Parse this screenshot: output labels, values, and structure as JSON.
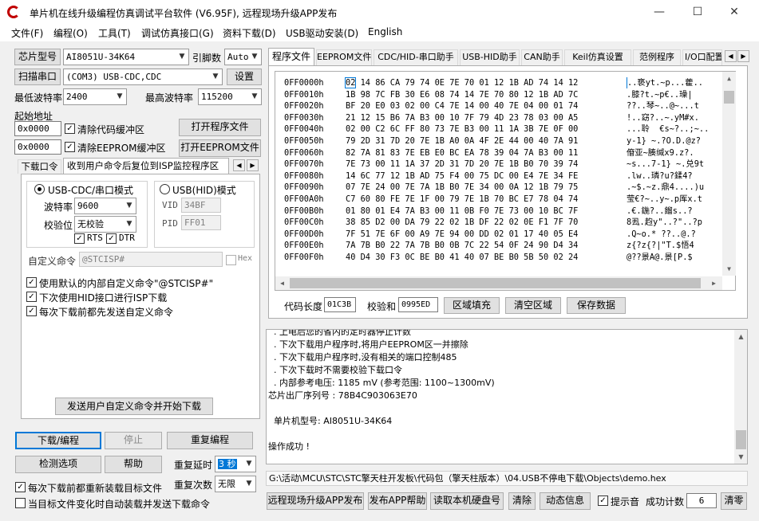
{
  "window": {
    "title": "单片机在线升级编程仿真调试平台软件 (V6.95F), 远程现场升级APP发布",
    "controls": [
      "—",
      "☐",
      "✕"
    ]
  },
  "menu": [
    "文件(F)",
    "编程(O)",
    "工具(T)",
    "调试仿真接口(G)",
    "资料下载(D)",
    "USB驱动安装(D)",
    "English"
  ],
  "left": {
    "chip_type_button": "芯片型号",
    "chip_type_value": "AI8051U-34K64",
    "pin_label": "引脚数",
    "pin_value": "Auto",
    "scan_port_button": "扫描串口",
    "port_value": "(COM3) USB-CDC,CDC",
    "settings_button": "设置",
    "min_baud_label": "最低波特率",
    "min_baud_value": "2400",
    "max_baud_label": "最高波特率",
    "max_baud_value": "115200",
    "start_addr_label": "起始地址",
    "addr1": "0x0000",
    "clear_code_label": "清除代码缓冲区",
    "open_prog_button": "打开程序文件",
    "addr2": "0x0000",
    "clear_eeprom_label": "清除EEPROM缓冲区",
    "open_eeprom_button": "打开EEPROM文件",
    "tabs": [
      "下载口令",
      "收到用户命令后复位到ISP监控程序区"
    ],
    "radio_cdc": "USB-CDC/串口模式",
    "radio_hid": "USB(HID)模式",
    "baud_label": "波特率",
    "baud_value": "9600",
    "parity_label": "校验位",
    "parity_value": "无校验",
    "rts_label": "RTS",
    "dtr_label": "DTR",
    "vid_label": "VID",
    "vid_value": "34BF",
    "pid_label": "PID",
    "pid_value": "FF01",
    "custom_cmd_label": "自定义命令",
    "custom_cmd_value": "@STCISP#",
    "hex_label": "Hex",
    "opt1": "使用默认的内部自定义命令\"@STCISP#\"",
    "opt2": "下次使用HID接口进行ISP下载",
    "opt3": "每次下载前都先发送自定义命令",
    "send_cmd_button": "发送用户自定义命令并开始下载",
    "download_button": "下载/编程",
    "stop_button": "停止",
    "reprogram_button": "重复编程",
    "detect_button": "检测选项",
    "help_button": "帮助",
    "repeat_delay_label": "重复延时",
    "repeat_delay_value": "3 秒",
    "repeat_count_label": "重复次数",
    "repeat_count_value": "无限",
    "reload_label": "每次下载前都重新装载目标文件",
    "auto_send_label": "当目标文件变化时自动装载并发送下载命令"
  },
  "right": {
    "tabs": [
      "程序文件",
      "EEPROM文件",
      "CDC/HID-串口助手",
      "USB-HID助手",
      "CAN助手",
      "Keil仿真设置",
      "范例程序",
      "I/O口配置"
    ],
    "hex_rows": [
      {
        "addr": "0FF0000h",
        "bytes": "02 14 86 CA 79 74 0E 7E 70 01 12 1B AD 74 14 12",
        "ascii": "..亵yt.~p...藿.."
      },
      {
        "addr": "0FF0010h",
        "bytes": "1B 98 7C FB 30 E6 08 74 14 7E 70 80 12 1B AD 7C",
        "ascii": ".膝?t.~p€..璪|"
      },
      {
        "addr": "0FF0020h",
        "bytes": "BF 20 E0 03 02 00 C4 7E 14 00 40 7E 04 00 01 74",
        "ascii": "??..琴~..@~...t"
      },
      {
        "addr": "0FF0030h",
        "bytes": "21 12 15 B6 7A B3 00 10 7F 79 4D 23 78 03 00 A5",
        "ascii": "!..窈?..~.yM#x."
      },
      {
        "addr": "0FF0040h",
        "bytes": "02 00 C2 6C FF 80 73 7E B3 00 11 1A 3B 7E 0F 00",
        "ascii": "...聆  €s~?..;~.."
      },
      {
        "addr": "0FF0050h",
        "bytes": "79 2D 31 7D 20 7E 1B A0 0A 4F 2E 44 00 40 7A 91",
        "ascii": "y-1} ~.?O.D.@z?"
      },
      {
        "addr": "0FF0060h",
        "bytes": "82 7A 81 83 7E EB E0 BC EA 78 39 04 7A B3 00 11",
        "ascii": "傄亚~腠缄x9.z?."
      },
      {
        "addr": "0FF0070h",
        "bytes": "7E 73 00 11 1A 37 2D 31 7D 20 7E 1B B0 70 39 74",
        "ascii": "~s...7-1} ~.兑9t"
      },
      {
        "addr": "0FF0080h",
        "bytes": "14 6C 77 12 1B AD 75 F4 00 75 DC 00 E4 7E 34 FE",
        "ascii": ".lw..璘?u?鍒4?"
      },
      {
        "addr": "0FF0090h",
        "bytes": "07 7E 24 00 7E 7A 1B B0 7E 34 00 0A 12 1B 79 75",
        "ascii": ".~$.~z.鼎4....)u"
      },
      {
        "addr": "0FF00A0h",
        "bytes": "C7 60 80 FE 7E 1F 00 79 7E 1B 70 BC E7 78 04 74",
        "ascii": "莹€?~..y~.p厍x.t"
      },
      {
        "addr": "0FF00B0h",
        "bytes": "01 80 01 E4 7A B3 00 11 0B F0 7E 73 00 10 BC 7F",
        "ascii": ".€.鍦?..餾s..?"
      },
      {
        "addr": "0FF00C0h",
        "bytes": "38 85 D2 00 DA 79 22 02 1B DF 22 02 0E F1 7F 70",
        "ascii": "8厾.赹y\"..?\"..?p"
      },
      {
        "addr": "0FF00D0h",
        "bytes": "7F 51 7E 6F 00 A9 7E 94 00 DD 02 01 17 40 05 E4",
        "ascii": ".Q~o.* ??..@.?"
      },
      {
        "addr": "0FF00E0h",
        "bytes": "7A 7B B0 22 7A 7B B0 0B 7C 22 54 0F 24 90 D4 34",
        "ascii": "z{?z{?|\"T.$悟4"
      },
      {
        "addr": "0FF00F0h",
        "bytes": "40 D4 30 F3 0C BE B0 41 40 07 BE B0 5B 50 02 24",
        "ascii": "@??景A@.景[P.$"
      }
    ],
    "code_len_label": "代码长度",
    "code_len_value": "01C3B",
    "checksum_label": "校验和",
    "checksum_value": "0995ED",
    "fill_button": "区域填充",
    "clear_area_button": "清空区域",
    "save_button": "保存数据",
    "log_lines": [
      "  . 上电后您的省内的定时器停止计数",
      "  . 下次下载用户程序时,将用户EEPROM区一并擦除",
      "  . 下次下载用户程序时,没有相关的端口控制485",
      "  . 下次下载时不需要校验下载口令",
      "  . 内部参考电压: 1185 mV (参考范围: 1100~1300mV)",
      "芯片出厂序列号 : 78B4C903063E70",
      "",
      "  单片机型号: AI8051U-34K64",
      "",
      "操作成功 !"
    ],
    "file_path": "G:\\活动\\MCU\\STC\\STC擎天柱开发板\\代码包（擎天柱版本）\\04.USB不停电下载\\Objects\\demo.hex",
    "bottom_buttons": [
      "远程现场升级APP发布",
      "发布APP帮助",
      "读取本机硬盘号",
      "清除",
      "动态信息"
    ],
    "beep_label": "提示音",
    "success_label": "成功计数",
    "success_value": "6",
    "clear_count_button": "清零"
  }
}
